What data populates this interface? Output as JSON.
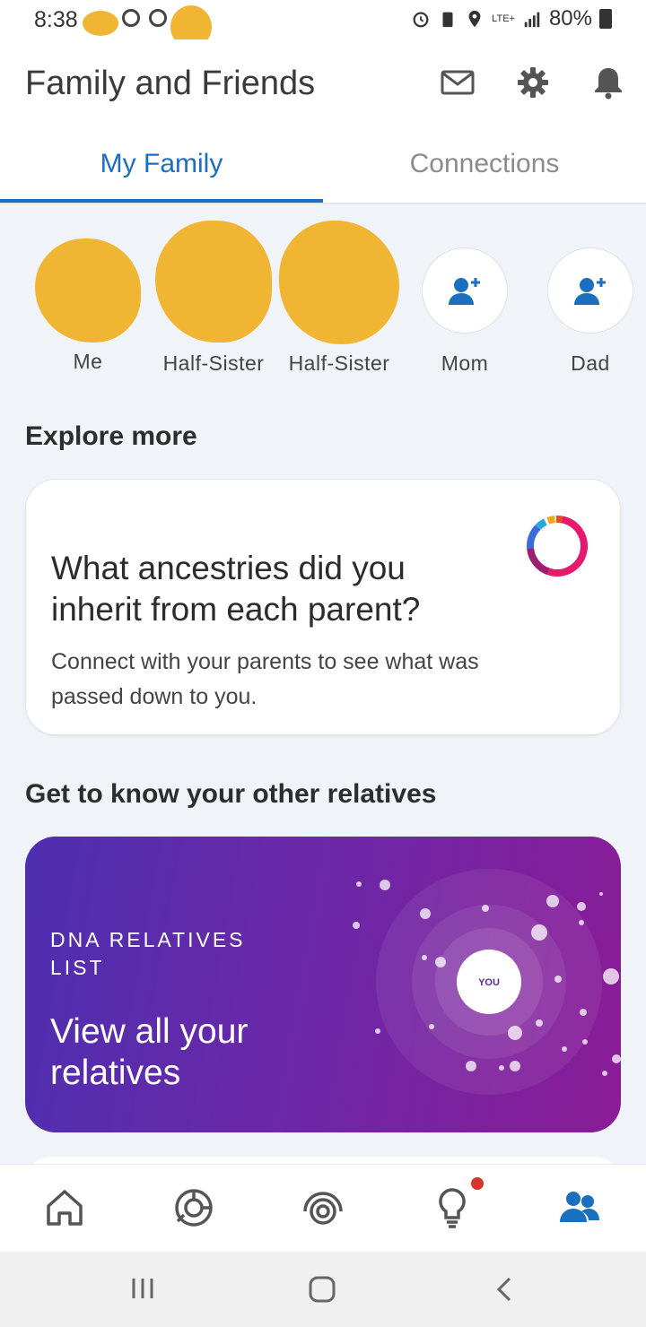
{
  "status_bar": {
    "time": "8:38",
    "network": "LTE+",
    "battery": "80%"
  },
  "app_bar": {
    "title": "Family and Friends"
  },
  "tabs": [
    {
      "label": "My Family",
      "active": true
    },
    {
      "label": "Connections",
      "active": false
    }
  ],
  "family": [
    {
      "label": "Me"
    },
    {
      "label": "Half-Sister"
    },
    {
      "label": "Half-Sister"
    },
    {
      "label": "Mom"
    },
    {
      "label": "Dad"
    }
  ],
  "explore": {
    "section_title": "Explore more",
    "card_question": "What ancestries did you inherit from each parent?",
    "card_description": "Connect with your parents to see what was passed down to you."
  },
  "relatives": {
    "section_title": "Get to know your other relatives",
    "kicker": "DNA RELATIVES LIST",
    "headline": "View all your relatives",
    "center_label": "YOU"
  },
  "colors": {
    "accent_blue": "#1a6fbf",
    "promo_start": "#4d2fb0",
    "promo_end": "#8b1c97",
    "notification_dot": "#d9352b"
  },
  "bottom_nav": [
    {
      "icon": "home-icon"
    },
    {
      "icon": "ancestry-icon"
    },
    {
      "icon": "dna-relatives-icon"
    },
    {
      "icon": "lightbulb-icon",
      "has_notification": true
    },
    {
      "icon": "family-friends-icon",
      "active": true
    }
  ]
}
